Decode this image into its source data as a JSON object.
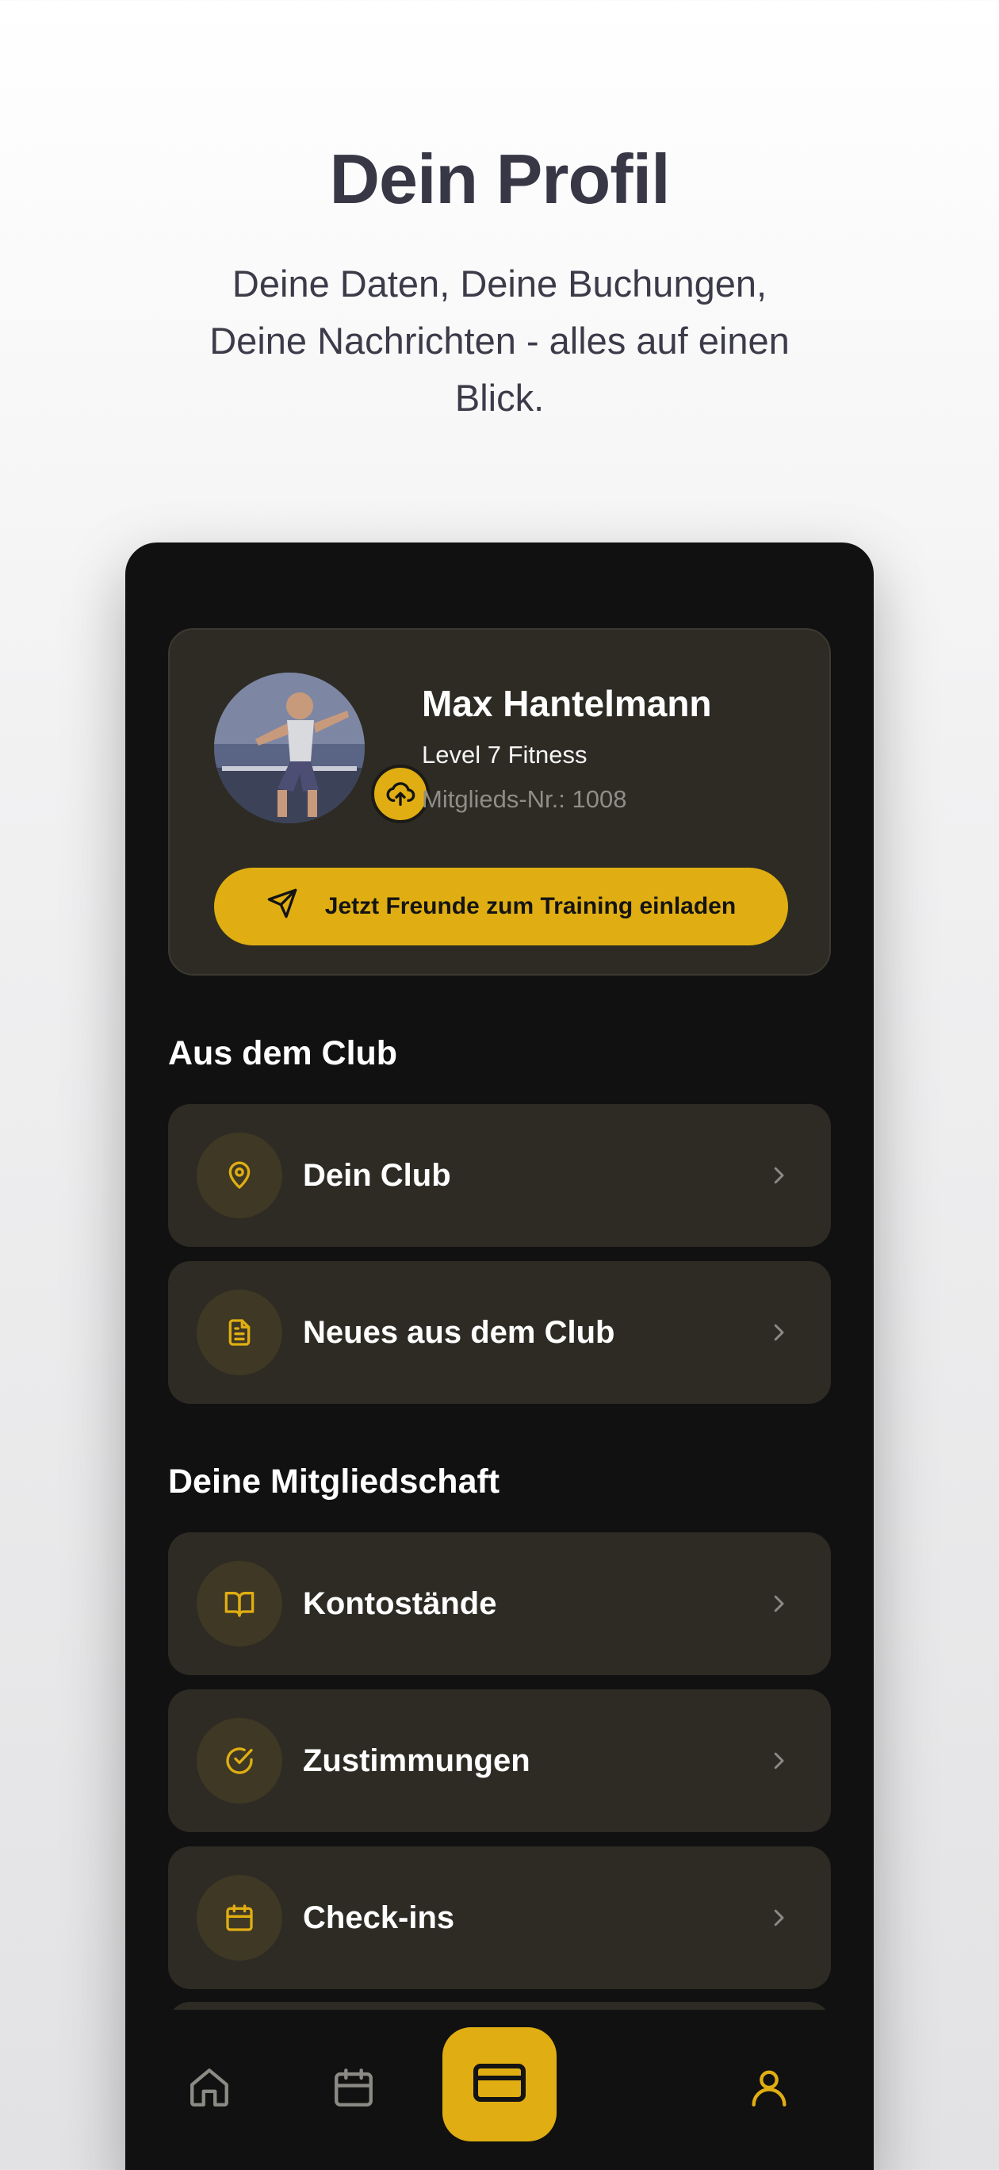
{
  "header": {
    "title": "Dein Profil",
    "subtitle": "Deine Daten, Deine Buchungen, Deine Nachrichten - alles auf einen Blick."
  },
  "profile": {
    "name": "Max Hantelmann",
    "level": "Level 7 Fitness",
    "member_no": "Mitglieds-Nr.: 1008",
    "avatar_icon": "user-photo",
    "upload_icon": "cloud-upload-icon",
    "invite_label": "Jetzt Freunde zum Training einladen",
    "invite_icon": "send-icon"
  },
  "sections": [
    {
      "title": "Aus dem Club",
      "items": [
        {
          "label": "Dein Club",
          "icon": "map-pin-icon"
        },
        {
          "label": "Neues aus dem Club",
          "icon": "document-icon"
        }
      ]
    },
    {
      "title": "Deine Mitgliedschaft",
      "items": [
        {
          "label": "Kontostände",
          "icon": "book-open-icon"
        },
        {
          "label": "Zustimmungen",
          "icon": "check-circle-icon"
        },
        {
          "label": "Check-ins",
          "icon": "calendar-icon"
        }
      ]
    }
  ],
  "tabbar": {
    "tabs": [
      {
        "icon": "home-icon",
        "active": false
      },
      {
        "icon": "calendar-icon",
        "active": false
      },
      {
        "icon": "card-icon",
        "active": true,
        "highlight": true
      },
      {
        "icon": "user-icon",
        "active": true
      },
      {
        "icon": "bell-icon",
        "active": false
      }
    ]
  },
  "colors": {
    "accent": "#e0ae12",
    "background_dark": "#111111",
    "card": "#2d2b24",
    "icon_circle": "#3f3824",
    "inactive_icon": "#8c8a84",
    "title_text": "#383746"
  }
}
